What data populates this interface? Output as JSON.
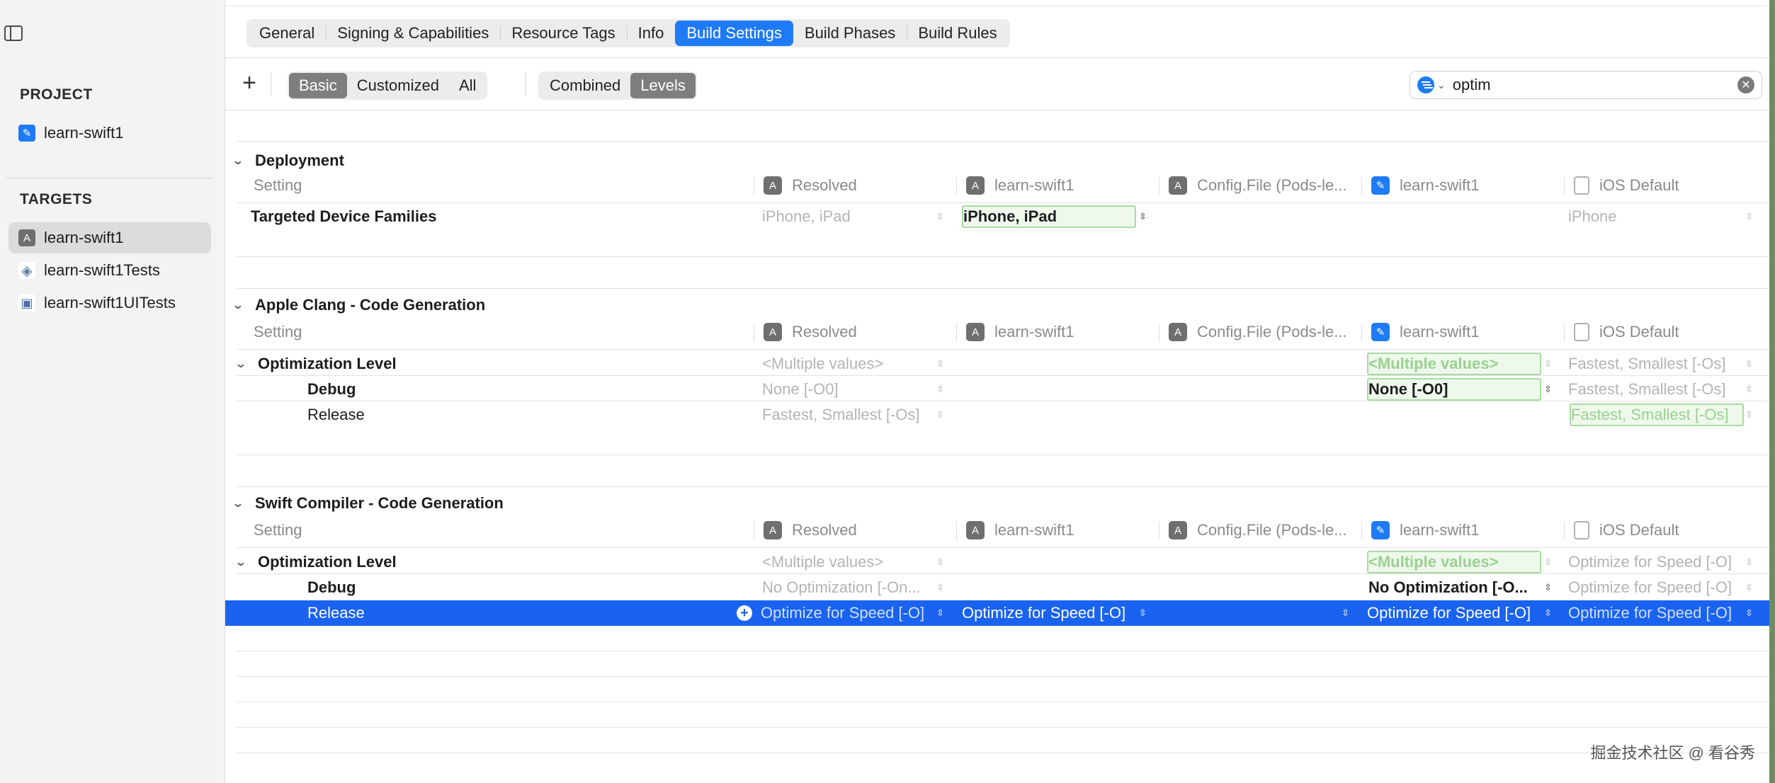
{
  "sidebar": {
    "project_heading": "PROJECT",
    "project_item": {
      "label": "learn-swift1",
      "icon": "project-icon"
    },
    "targets_heading": "TARGETS",
    "targets": [
      {
        "label": "learn-swift1",
        "icon": "app-target-icon",
        "selected": true
      },
      {
        "label": "learn-swift1Tests",
        "icon": "unit-test-icon",
        "selected": false
      },
      {
        "label": "learn-swift1UITests",
        "icon": "ui-test-icon",
        "selected": false
      }
    ]
  },
  "tabs": [
    {
      "label": "General",
      "active": false
    },
    {
      "label": "Signing & Capabilities",
      "active": false
    },
    {
      "label": "Resource Tags",
      "active": false
    },
    {
      "label": "Info",
      "active": false
    },
    {
      "label": "Build Settings",
      "active": true
    },
    {
      "label": "Build Phases",
      "active": false
    },
    {
      "label": "Build Rules",
      "active": false
    }
  ],
  "toolbar": {
    "add_label": "+",
    "filter_segment": [
      "Basic",
      "Customized",
      "All"
    ],
    "filter_selected": "Basic",
    "view_segment": [
      "Combined",
      "Levels"
    ],
    "view_selected": "Levels",
    "search_value": "optim"
  },
  "columns": {
    "setting": "Setting",
    "resolved": "Resolved",
    "target": "learn-swift1",
    "config_file": "Config.File (Pods-le...",
    "project": "learn-swift1",
    "ios_default": "iOS Default"
  },
  "sections": [
    {
      "title": "Deployment",
      "rows": [
        {
          "name": "Targeted Device Families",
          "resolved": "iPhone, iPad",
          "target": "iPhone, iPad",
          "config": "",
          "project": "",
          "default": "iPhone"
        }
      ]
    },
    {
      "title": "Apple Clang - Code Generation",
      "rows": [
        {
          "name": "Optimization Level",
          "resolved": "<Multiple values>",
          "target": "",
          "config": "",
          "project": "<Multiple values>",
          "default": "Fastest, Smallest [-Os]"
        },
        {
          "name": "Debug",
          "resolved": "None [-O0]",
          "target": "",
          "config": "",
          "project": "None [-O0]",
          "default": "Fastest, Smallest [-Os]"
        },
        {
          "name": "Release",
          "resolved": "Fastest, Smallest [-Os]",
          "target": "",
          "config": "",
          "project": "",
          "default": "Fastest, Smallest [-Os]"
        }
      ]
    },
    {
      "title": "Swift Compiler - Code Generation",
      "rows": [
        {
          "name": "Optimization Level",
          "resolved": "<Multiple values>",
          "target": "",
          "config": "",
          "project": "<Multiple values>",
          "default": "Optimize for Speed [-O]"
        },
        {
          "name": "Debug",
          "resolved": "No Optimization [-On...",
          "target": "",
          "config": "",
          "project": "No Optimization [-O...",
          "default": "Optimize for Speed [-O]"
        },
        {
          "name": "Release",
          "resolved": "Optimize for Speed [-O]",
          "target": "Optimize for Speed [-O]",
          "config": "",
          "project": "Optimize for Speed [-O]",
          "default": "Optimize for Speed [-O]"
        }
      ]
    }
  ],
  "watermark": "掘金技术社区 @ 看谷秀",
  "colors": {
    "accent": "#1f7bf5",
    "selection": "#1a62f0",
    "highlight_border": "#a8dca0"
  }
}
